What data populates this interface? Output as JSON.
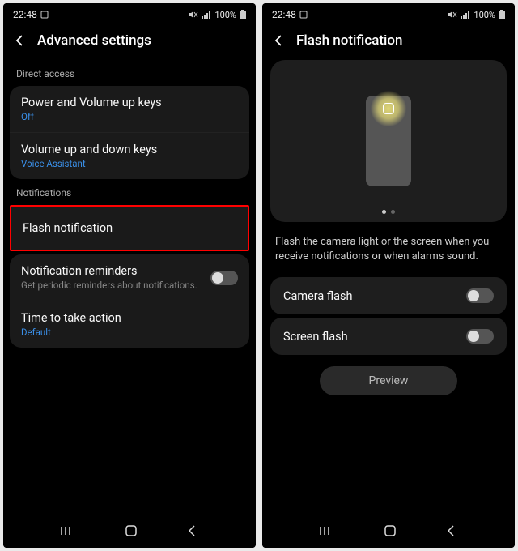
{
  "statusbar": {
    "time": "22:48",
    "battery": "100%"
  },
  "screen1": {
    "title": "Advanced settings",
    "sections": {
      "direct_access": {
        "label": "Direct access",
        "items": [
          {
            "title": "Power and Volume up keys",
            "sub": "Off"
          },
          {
            "title": "Volume up and down keys",
            "sub": "Voice Assistant"
          }
        ]
      },
      "notifications": {
        "label": "Notifications",
        "flash": {
          "title": "Flash notification"
        },
        "items": [
          {
            "title": "Notification reminders",
            "sub": "Get periodic reminders about notifications."
          },
          {
            "title": "Time to take action",
            "sub": "Default"
          }
        ]
      }
    }
  },
  "screen2": {
    "title": "Flash notification",
    "description": "Flash the camera light or the screen when you receive notifications or when alarms sound.",
    "options": {
      "camera": "Camera flash",
      "screen": "Screen flash"
    },
    "preview": "Preview"
  }
}
